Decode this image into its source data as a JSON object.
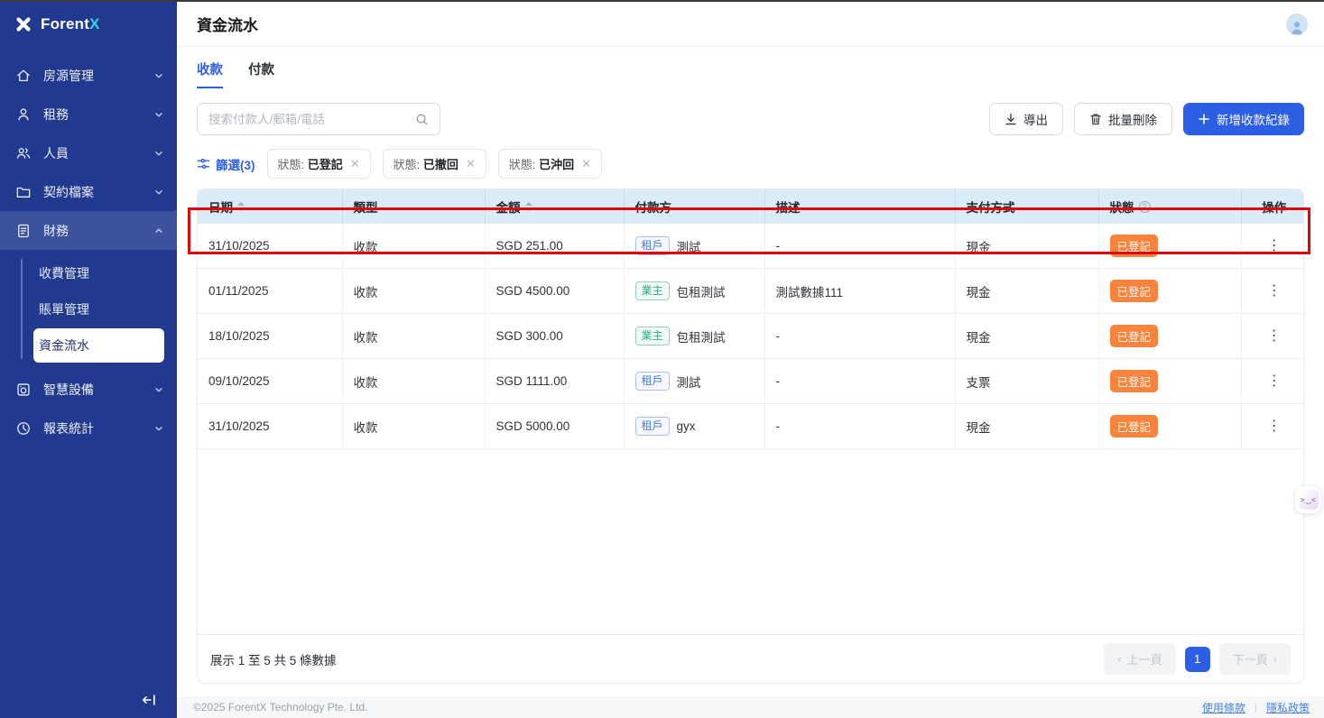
{
  "brand": {
    "name": "Forent",
    "accent": "X"
  },
  "page": {
    "title": "資金流水"
  },
  "tabs": [
    {
      "label": "收款",
      "active": true
    },
    {
      "label": "付款",
      "active": false
    }
  ],
  "toolbar": {
    "search_placeholder": "搜索付款人/郵箱/電話",
    "export_label": "導出",
    "batch_delete_label": "批量刪除",
    "add_label": "新增收款紀錄"
  },
  "filter": {
    "label": "篩選(3)",
    "chips": [
      {
        "field": "狀態:",
        "value": "已登記"
      },
      {
        "field": "狀態:",
        "value": "已撤回"
      },
      {
        "field": "狀態:",
        "value": "已沖回"
      }
    ]
  },
  "sidebar": {
    "items": [
      {
        "label": "房源管理",
        "icon": "home-icon",
        "chevron": "down",
        "open": false
      },
      {
        "label": "租務",
        "icon": "user-icon",
        "chevron": "down",
        "open": false
      },
      {
        "label": "人員",
        "icon": "users-icon",
        "chevron": "down",
        "open": false
      },
      {
        "label": "契約檔案",
        "icon": "folder-icon",
        "chevron": "down",
        "open": false
      },
      {
        "label": "財務",
        "icon": "finance-icon",
        "chevron": "up",
        "open": true,
        "children": [
          {
            "label": "收費管理",
            "active": false
          },
          {
            "label": "賬單管理",
            "active": false
          },
          {
            "label": "資金流水",
            "active": true
          }
        ]
      },
      {
        "label": "智慧設備",
        "icon": "device-icon",
        "chevron": "down",
        "open": false
      },
      {
        "label": "報表統計",
        "icon": "report-icon",
        "chevron": "down",
        "open": false
      }
    ]
  },
  "table": {
    "columns": [
      {
        "key": "date",
        "label": "日期",
        "sortable": true
      },
      {
        "key": "type",
        "label": "類型"
      },
      {
        "key": "amount",
        "label": "金額",
        "sortable": true
      },
      {
        "key": "payer",
        "label": "付款方"
      },
      {
        "key": "desc",
        "label": "描述"
      },
      {
        "key": "method",
        "label": "支付方式"
      },
      {
        "key": "status",
        "label": "狀態",
        "help": true
      },
      {
        "key": "actions",
        "label": "操作",
        "align": "center"
      }
    ],
    "rows": [
      {
        "date": "31/10/2025",
        "type": "收款",
        "amount": "SGD 251.00",
        "payer_tag": "租戶",
        "payer": "測試",
        "desc": "-",
        "method": "現金",
        "status": "已登記",
        "highlighted": true
      },
      {
        "date": "01/11/2025",
        "type": "收款",
        "amount": "SGD 4500.00",
        "payer_tag": "業主",
        "payer": "包租測試",
        "desc": "測試數據111",
        "method": "現金",
        "status": "已登記",
        "highlighted": false
      },
      {
        "date": "18/10/2025",
        "type": "收款",
        "amount": "SGD 300.00",
        "payer_tag": "業主",
        "payer": "包租測試",
        "desc": "-",
        "method": "現金",
        "status": "已登記",
        "highlighted": false
      },
      {
        "date": "09/10/2025",
        "type": "收款",
        "amount": "SGD 1111.00",
        "payer_tag": "租戶",
        "payer": "測試",
        "desc": "-",
        "method": "支票",
        "status": "已登記",
        "highlighted": false
      },
      {
        "date": "31/10/2025",
        "type": "收款",
        "amount": "SGD 5000.00",
        "payer_tag": "租戶",
        "payer": "gyx",
        "desc": "-",
        "method": "現金",
        "status": "已登記",
        "highlighted": false
      }
    ],
    "tag_styles": {
      "租戶": "tenant",
      "業主": "landlord"
    }
  },
  "pagination": {
    "summary": "展示 1 至 5 共 5 條數據",
    "prev_label": "上一頁",
    "next_label": "下一頁",
    "current_page": "1"
  },
  "footer": {
    "copyright": "©2025 ForentX Technology Pte. Ltd.",
    "terms": "使用條款",
    "privacy": "隱私政策"
  },
  "assistant": {
    "face": ">‿<"
  },
  "colors": {
    "primary": "#2c5fe6",
    "sidebar_bg": "#21398f",
    "logo_accent": "#2bd9ea",
    "table_header_bg": "#d9ecf8",
    "status_registered": "#f7833c",
    "tenant_tag": "#4b7be0",
    "landlord_tag": "#35a98c",
    "annotation_red": "#e30505"
  }
}
